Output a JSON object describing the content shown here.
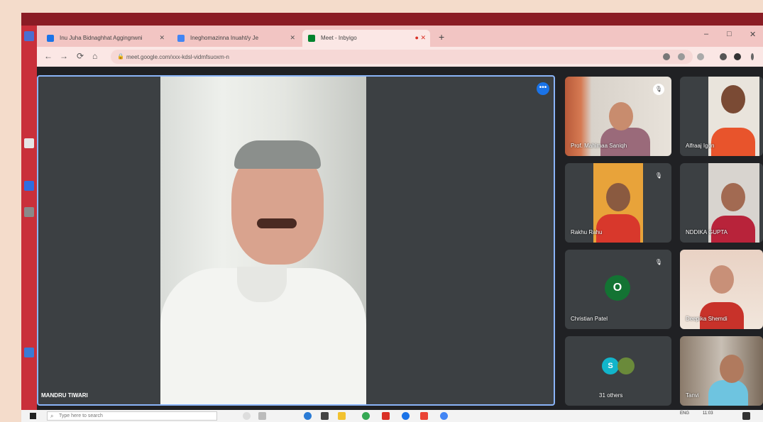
{
  "browser": {
    "tabs": [
      {
        "label": "Inu Juha Bidnaghhat Aggingnwni"
      },
      {
        "label": "Ineghomazinna Inuaht/y Je"
      },
      {
        "label": "Meet - Inbyigo"
      }
    ],
    "url": "meet.google.com/xxx-kdsl-vidmfsuoxm-n"
  },
  "meet": {
    "main_speaker": {
      "name": "MANDRU TIWARI"
    },
    "participants": [
      {
        "name": "Prof. Mahimaa Saniqh",
        "muted": true
      },
      {
        "name": "Alfraaj Igon",
        "muted": false
      },
      {
        "name": "Rakhu Rahu",
        "muted": true
      },
      {
        "name": "NDDIKA GUPTA",
        "muted": false
      },
      {
        "name": "Christian Patel",
        "muted": true,
        "avatar_letter": "O",
        "avatar_color": "#137333"
      },
      {
        "name": "Deepika Shemdi",
        "muted": false
      },
      {
        "name": "31 others",
        "avatar_letter": "S",
        "avatar_color": "#12b5cb"
      },
      {
        "name": "Tanvi",
        "muted": false
      }
    ]
  },
  "taskbar": {
    "search_placeholder": "Type here to search",
    "lang": "ENG",
    "time": "11:03"
  },
  "colors": {
    "accent": "#1a73e8",
    "tile": "#3c4043",
    "background": "#202124"
  }
}
